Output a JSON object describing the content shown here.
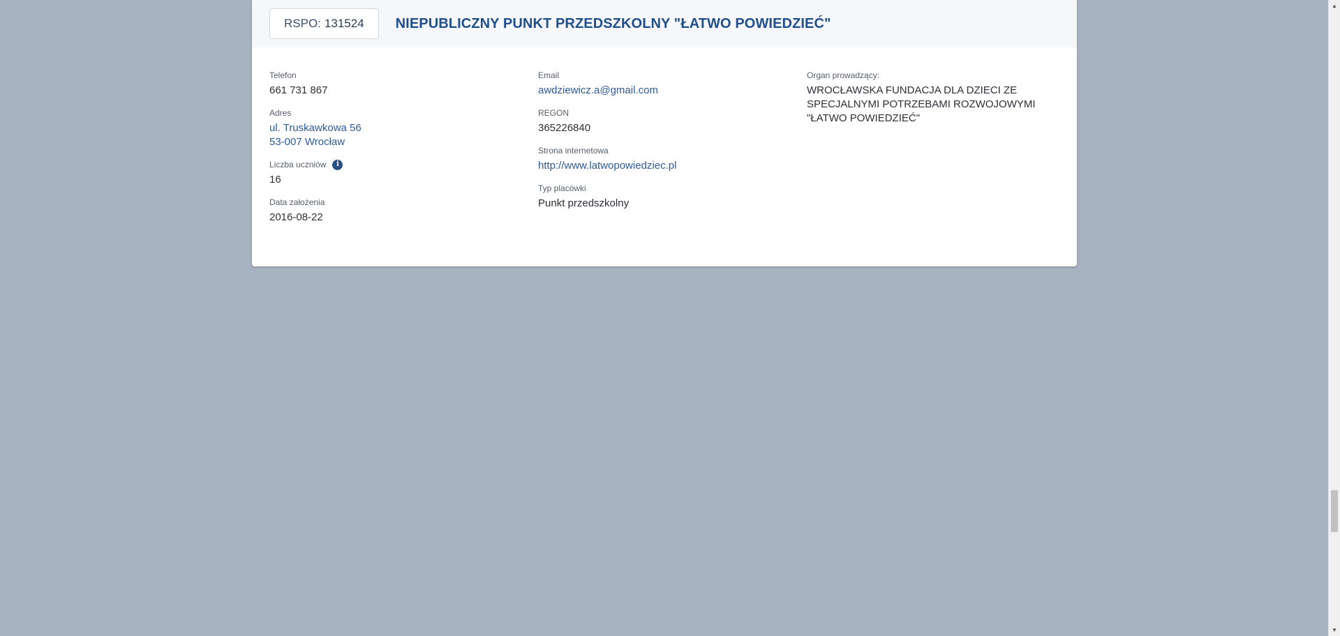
{
  "school": {
    "rspo_label": "RSPO:",
    "rspo_value": "131524",
    "name": "NIEPUBLICZNY PUNKT PRZEDSZKOLNY \"ŁATWO POWIEDZIEĆ\""
  },
  "fields": {
    "telefon": {
      "label": "Telefon",
      "value": "661 731 867"
    },
    "adres": {
      "label": "Adres",
      "line1": "ul. Truskawkowa 56",
      "line2": "53-007 Wrocław"
    },
    "liczba_uczniow": {
      "label": "Liczba uczniów",
      "value": "16",
      "info_icon": "info-icon"
    },
    "data_zalozenia": {
      "label": "Data założenia",
      "value": "2016-08-22"
    },
    "email": {
      "label": "Email",
      "value": "awdziewicz.a@gmail.com"
    },
    "regon": {
      "label": "REGON",
      "value": "365226840"
    },
    "strona": {
      "label": "Strona internetowa",
      "value": "http://www.latwopowiedziec.pl"
    },
    "typ": {
      "label": "Typ placówki",
      "value": "Punkt przedszkolny"
    },
    "organ": {
      "label": "Organ prowadzący:",
      "line1": "WROCŁAWSKA FUNDACJA DLA DZIECI ZE",
      "line2": "SPECJALNYMI POTRZEBAMI ROZWOJOWYMI",
      "line3": "\"ŁATWO POWIEDZIEĆ\""
    }
  },
  "scrollbar": {
    "up_icon": "triangle-up-icon",
    "down_icon": "triangle-down-icon",
    "position_fraction": 0.86
  },
  "colors": {
    "background": "#a8b3c1",
    "title": "#1f4e8c",
    "link": "#2d5a9a",
    "header_bg": "#f5f7fa"
  }
}
